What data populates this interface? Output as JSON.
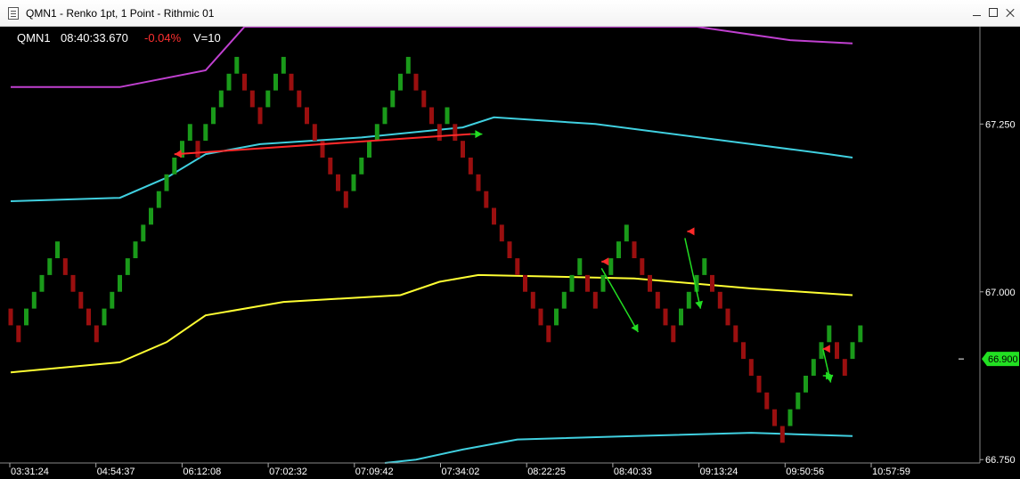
{
  "window": {
    "title": "QMN1 - Renko 1pt, 1 Point - Rithmic 01"
  },
  "quote": {
    "symbol": "QMN1",
    "time": "08:40:33.670",
    "change": "-0.04%",
    "volume": "V=10"
  },
  "colors": {
    "background": "#000000",
    "up_brick": "#1a9a1a",
    "down_brick": "#9a0f0f",
    "upper_band_outer": "#c040d0",
    "band_inner": "#40d0e0",
    "midline": "#ffff33",
    "red_trend": "#ff2a2a",
    "green_trend": "#22dd22",
    "change_negative": "#ff3030",
    "price_badge": "#22e022"
  },
  "chart_data": {
    "type": "renko",
    "x_tick_labels": [
      "03:31:24",
      "04:54:37",
      "06:12:08",
      "07:02:32",
      "07:09:42",
      "07:34:02",
      "08:22:25",
      "08:40:33",
      "09:13:24",
      "09:50:56",
      "10:57:59"
    ],
    "y_ticks": [
      67.25,
      67.0,
      66.75
    ],
    "y_tick_labels": [
      "67.250",
      "67.000",
      "66.750"
    ],
    "ylim": [
      66.745,
      67.395
    ],
    "last_price": 66.9,
    "last_price_label": "66.900",
    "brick_size": 0.025,
    "bricks": [
      {
        "dir": "down",
        "low": 66.95,
        "high": 66.975
      },
      {
        "dir": "down",
        "low": 66.925,
        "high": 66.95
      },
      {
        "dir": "up",
        "low": 66.95,
        "high": 66.975
      },
      {
        "dir": "up",
        "low": 66.975,
        "high": 67.0
      },
      {
        "dir": "up",
        "low": 67.0,
        "high": 67.025
      },
      {
        "dir": "up",
        "low": 67.025,
        "high": 67.05
      },
      {
        "dir": "up",
        "low": 67.05,
        "high": 67.075
      },
      {
        "dir": "down",
        "low": 67.025,
        "high": 67.05
      },
      {
        "dir": "down",
        "low": 67.0,
        "high": 67.025
      },
      {
        "dir": "down",
        "low": 66.975,
        "high": 67.0
      },
      {
        "dir": "down",
        "low": 66.95,
        "high": 66.975
      },
      {
        "dir": "down",
        "low": 66.925,
        "high": 66.95
      },
      {
        "dir": "up",
        "low": 66.95,
        "high": 66.975
      },
      {
        "dir": "up",
        "low": 66.975,
        "high": 67.0
      },
      {
        "dir": "up",
        "low": 67.0,
        "high": 67.025
      },
      {
        "dir": "up",
        "low": 67.025,
        "high": 67.05
      },
      {
        "dir": "up",
        "low": 67.05,
        "high": 67.075
      },
      {
        "dir": "up",
        "low": 67.075,
        "high": 67.1
      },
      {
        "dir": "up",
        "low": 67.1,
        "high": 67.125
      },
      {
        "dir": "up",
        "low": 67.125,
        "high": 67.15
      },
      {
        "dir": "up",
        "low": 67.15,
        "high": 67.175
      },
      {
        "dir": "up",
        "low": 67.175,
        "high": 67.2
      },
      {
        "dir": "up",
        "low": 67.2,
        "high": 67.225
      },
      {
        "dir": "up",
        "low": 67.225,
        "high": 67.25
      },
      {
        "dir": "down",
        "low": 67.2,
        "high": 67.225
      },
      {
        "dir": "up",
        "low": 67.225,
        "high": 67.25
      },
      {
        "dir": "up",
        "low": 67.25,
        "high": 67.275
      },
      {
        "dir": "up",
        "low": 67.275,
        "high": 67.3
      },
      {
        "dir": "up",
        "low": 67.3,
        "high": 67.325
      },
      {
        "dir": "up",
        "low": 67.325,
        "high": 67.35
      },
      {
        "dir": "down",
        "low": 67.3,
        "high": 67.325
      },
      {
        "dir": "down",
        "low": 67.275,
        "high": 67.3
      },
      {
        "dir": "down",
        "low": 67.25,
        "high": 67.275
      },
      {
        "dir": "up",
        "low": 67.275,
        "high": 67.3
      },
      {
        "dir": "up",
        "low": 67.3,
        "high": 67.325
      },
      {
        "dir": "up",
        "low": 67.325,
        "high": 67.35
      },
      {
        "dir": "down",
        "low": 67.3,
        "high": 67.325
      },
      {
        "dir": "down",
        "low": 67.275,
        "high": 67.3
      },
      {
        "dir": "down",
        "low": 67.25,
        "high": 67.275
      },
      {
        "dir": "down",
        "low": 67.225,
        "high": 67.25
      },
      {
        "dir": "down",
        "low": 67.2,
        "high": 67.225
      },
      {
        "dir": "down",
        "low": 67.175,
        "high": 67.2
      },
      {
        "dir": "down",
        "low": 67.15,
        "high": 67.175
      },
      {
        "dir": "down",
        "low": 67.125,
        "high": 67.15
      },
      {
        "dir": "up",
        "low": 67.15,
        "high": 67.175
      },
      {
        "dir": "up",
        "low": 67.175,
        "high": 67.2
      },
      {
        "dir": "up",
        "low": 67.2,
        "high": 67.225
      },
      {
        "dir": "up",
        "low": 67.225,
        "high": 67.25
      },
      {
        "dir": "up",
        "low": 67.25,
        "high": 67.275
      },
      {
        "dir": "up",
        "low": 67.275,
        "high": 67.3
      },
      {
        "dir": "up",
        "low": 67.3,
        "high": 67.325
      },
      {
        "dir": "up",
        "low": 67.325,
        "high": 67.35
      },
      {
        "dir": "down",
        "low": 67.3,
        "high": 67.325
      },
      {
        "dir": "down",
        "low": 67.275,
        "high": 67.3
      },
      {
        "dir": "down",
        "low": 67.25,
        "high": 67.275
      },
      {
        "dir": "down",
        "low": 67.225,
        "high": 67.25
      },
      {
        "dir": "up",
        "low": 67.25,
        "high": 67.275
      },
      {
        "dir": "down",
        "low": 67.225,
        "high": 67.25
      },
      {
        "dir": "down",
        "low": 67.2,
        "high": 67.225
      },
      {
        "dir": "down",
        "low": 67.175,
        "high": 67.2
      },
      {
        "dir": "down",
        "low": 67.15,
        "high": 67.175
      },
      {
        "dir": "down",
        "low": 67.125,
        "high": 67.15
      },
      {
        "dir": "down",
        "low": 67.1,
        "high": 67.125
      },
      {
        "dir": "down",
        "low": 67.075,
        "high": 67.1
      },
      {
        "dir": "down",
        "low": 67.05,
        "high": 67.075
      },
      {
        "dir": "down",
        "low": 67.025,
        "high": 67.05
      },
      {
        "dir": "down",
        "low": 67.0,
        "high": 67.025
      },
      {
        "dir": "down",
        "low": 66.975,
        "high": 67.0
      },
      {
        "dir": "down",
        "low": 66.95,
        "high": 66.975
      },
      {
        "dir": "down",
        "low": 66.925,
        "high": 66.95
      },
      {
        "dir": "up",
        "low": 66.95,
        "high": 66.975
      },
      {
        "dir": "up",
        "low": 66.975,
        "high": 67.0
      },
      {
        "dir": "up",
        "low": 67.0,
        "high": 67.025
      },
      {
        "dir": "up",
        "low": 67.025,
        "high": 67.05
      },
      {
        "dir": "down",
        "low": 67.0,
        "high": 67.025
      },
      {
        "dir": "down",
        "low": 66.975,
        "high": 67.0
      },
      {
        "dir": "up",
        "low": 67.0,
        "high": 67.025
      },
      {
        "dir": "up",
        "low": 67.025,
        "high": 67.05
      },
      {
        "dir": "up",
        "low": 67.05,
        "high": 67.075
      },
      {
        "dir": "up",
        "low": 67.075,
        "high": 67.1
      },
      {
        "dir": "down",
        "low": 67.05,
        "high": 67.075
      },
      {
        "dir": "down",
        "low": 67.025,
        "high": 67.05
      },
      {
        "dir": "down",
        "low": 67.0,
        "high": 67.025
      },
      {
        "dir": "down",
        "low": 66.975,
        "high": 67.0
      },
      {
        "dir": "down",
        "low": 66.95,
        "high": 66.975
      },
      {
        "dir": "down",
        "low": 66.925,
        "high": 66.95
      },
      {
        "dir": "up",
        "low": 66.95,
        "high": 66.975
      },
      {
        "dir": "up",
        "low": 66.975,
        "high": 67.0
      },
      {
        "dir": "up",
        "low": 67.0,
        "high": 67.025
      },
      {
        "dir": "up",
        "low": 67.025,
        "high": 67.05
      },
      {
        "dir": "down",
        "low": 67.0,
        "high": 67.025
      },
      {
        "dir": "down",
        "low": 66.975,
        "high": 67.0
      },
      {
        "dir": "down",
        "low": 66.95,
        "high": 66.975
      },
      {
        "dir": "down",
        "low": 66.925,
        "high": 66.95
      },
      {
        "dir": "down",
        "low": 66.9,
        "high": 66.925
      },
      {
        "dir": "down",
        "low": 66.875,
        "high": 66.9
      },
      {
        "dir": "down",
        "low": 66.85,
        "high": 66.875
      },
      {
        "dir": "down",
        "low": 66.825,
        "high": 66.85
      },
      {
        "dir": "down",
        "low": 66.8,
        "high": 66.825
      },
      {
        "dir": "down",
        "low": 66.775,
        "high": 66.8
      },
      {
        "dir": "up",
        "low": 66.8,
        "high": 66.825
      },
      {
        "dir": "up",
        "low": 66.825,
        "high": 66.85
      },
      {
        "dir": "up",
        "low": 66.85,
        "high": 66.875
      },
      {
        "dir": "up",
        "low": 66.875,
        "high": 66.9
      },
      {
        "dir": "up",
        "low": 66.9,
        "high": 66.925
      },
      {
        "dir": "up",
        "low": 66.925,
        "high": 66.95
      },
      {
        "dir": "down",
        "low": 66.9,
        "high": 66.925
      },
      {
        "dir": "down",
        "low": 66.875,
        "high": 66.9
      },
      {
        "dir": "up",
        "low": 66.9,
        "high": 66.925
      },
      {
        "dir": "up",
        "low": 66.925,
        "high": 66.95
      }
    ],
    "indicator_lines": [
      {
        "name_key": "upper_outer",
        "color_key": "upper_band_outer",
        "points": [
          [
            0,
            67.305
          ],
          [
            14,
            67.305
          ],
          [
            25,
            67.33
          ],
          [
            30,
            67.395
          ],
          [
            88,
            67.395
          ],
          [
            100,
            67.375
          ],
          [
            108,
            67.37
          ]
        ]
      },
      {
        "name_key": "upper_inner",
        "color_key": "band_inner",
        "points": [
          [
            0,
            67.135
          ],
          [
            14,
            67.14
          ],
          [
            20,
            67.17
          ],
          [
            25,
            67.205
          ],
          [
            32,
            67.22
          ],
          [
            45,
            67.23
          ],
          [
            58,
            67.245
          ],
          [
            62,
            67.26
          ],
          [
            75,
            67.25
          ],
          [
            95,
            67.22
          ],
          [
            105,
            67.205
          ],
          [
            108,
            67.2
          ]
        ]
      },
      {
        "name_key": "midline",
        "color_key": "midline",
        "points": [
          [
            0,
            66.88
          ],
          [
            14,
            66.895
          ],
          [
            20,
            66.925
          ],
          [
            25,
            66.965
          ],
          [
            35,
            66.985
          ],
          [
            50,
            66.995
          ],
          [
            55,
            67.015
          ],
          [
            60,
            67.025
          ],
          [
            80,
            67.02
          ],
          [
            95,
            67.005
          ],
          [
            108,
            66.995
          ]
        ]
      },
      {
        "name_key": "lower_inner",
        "color_key": "band_inner",
        "points": [
          [
            48,
            66.745
          ],
          [
            52,
            66.75
          ],
          [
            58,
            66.765
          ],
          [
            65,
            66.78
          ],
          [
            80,
            66.785
          ],
          [
            95,
            66.79
          ],
          [
            108,
            66.785
          ]
        ]
      }
    ],
    "trend_lines": [
      {
        "color_key": "red_trend",
        "from": [
          21,
          67.205
        ],
        "to": [
          59,
          67.235
        ],
        "arrow": "start"
      },
      {
        "color_key": "green_trend",
        "from": [
          59,
          67.235
        ],
        "to": [
          60.5,
          67.235
        ],
        "arrow": "end"
      },
      {
        "color_key": "green_trend",
        "from": [
          75.8,
          67.035
        ],
        "to": [
          80.5,
          66.94
        ],
        "arrow": "end"
      },
      {
        "color_key": "red_trend",
        "from": [
          75.8,
          67.045
        ],
        "to": [
          76.5,
          67.045
        ],
        "arrow": "start"
      },
      {
        "color_key": "green_trend",
        "from": [
          86.5,
          67.08
        ],
        "to": [
          88.5,
          66.975
        ],
        "arrow": "end"
      },
      {
        "color_key": "red_trend",
        "from": [
          86.8,
          67.09
        ],
        "to": [
          87.5,
          67.09
        ],
        "arrow": "start"
      },
      {
        "color_key": "green_trend",
        "from": [
          104.2,
          66.915
        ],
        "to": [
          105.2,
          66.865
        ],
        "arrow": "end"
      },
      {
        "color_key": "red_trend",
        "from": [
          104.2,
          66.915
        ],
        "to": [
          104.9,
          66.915
        ],
        "arrow": "start"
      },
      {
        "color_key": "green_trend",
        "from": [
          104.2,
          66.875
        ],
        "to": [
          105.5,
          66.875
        ],
        "arrow": "end"
      }
    ]
  }
}
